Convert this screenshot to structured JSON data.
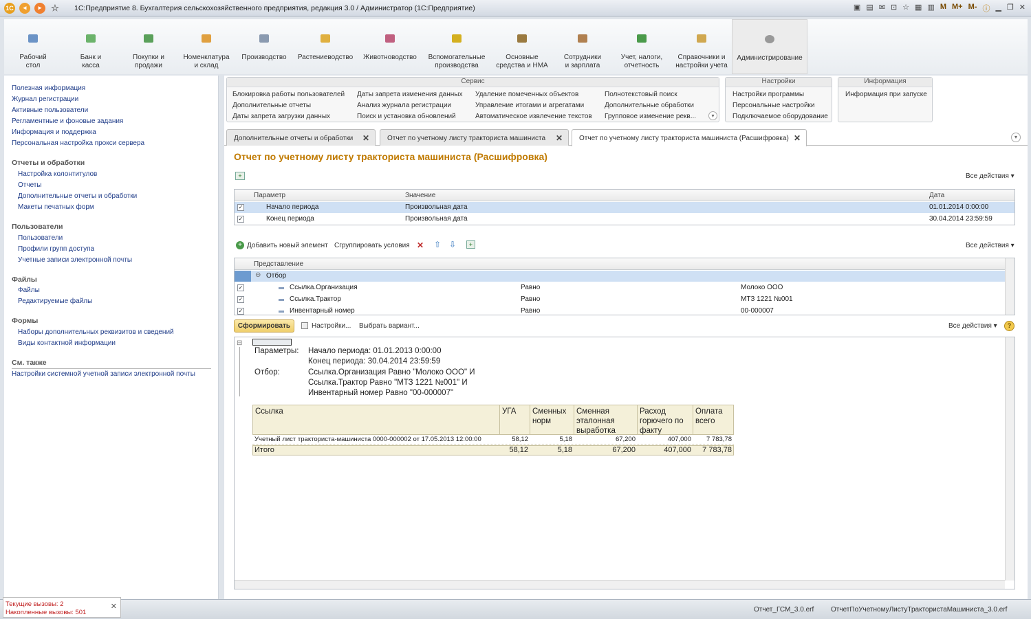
{
  "window": {
    "title": "1С:Предприятие 8. Бухгалтерия сельскохозяйственного предприятия, редакция 3.0 / Администратор  (1С:Предприятие)",
    "right_labels": [
      "M",
      "M+",
      "M-"
    ]
  },
  "sections": [
    {
      "label": "Рабочий\nстол",
      "icon": "desktop-icon"
    },
    {
      "label": "Банк и\nкасса",
      "icon": "bank-icon"
    },
    {
      "label": "Покупки и\nпродажи",
      "icon": "cart-icon"
    },
    {
      "label": "Номенклатура\nи склад",
      "icon": "box-icon"
    },
    {
      "label": "Производство",
      "icon": "factory-icon"
    },
    {
      "label": "Растениеводство",
      "icon": "plant-icon"
    },
    {
      "label": "Животноводство",
      "icon": "cow-icon"
    },
    {
      "label": "Вспомогательные\nпроизводства",
      "icon": "gear-yellow-icon"
    },
    {
      "label": "Основные\nсредства и НМА",
      "icon": "tractor-icon"
    },
    {
      "label": "Сотрудники\nи зарплата",
      "icon": "people-icon"
    },
    {
      "label": "Учет, налоги,\nотчетность",
      "icon": "book-icon"
    },
    {
      "label": "Справочники и\nнастройки учета",
      "icon": "folder-icon"
    },
    {
      "label": "Администрирование",
      "icon": "gear-icon"
    }
  ],
  "left_panel": {
    "top_links": [
      "Полезная информация",
      "Журнал регистрации",
      "Активные пользователи",
      "Регламентные и фоновые задания",
      "Информация и поддержка",
      "Персональная настройка прокси сервера"
    ],
    "groups": [
      {
        "title": "Отчеты и обработки",
        "items": [
          "Настройка колонтитулов",
          "Отчеты",
          "Дополнительные отчеты и обработки",
          "Макеты печатных форм"
        ]
      },
      {
        "title": "Пользователи",
        "items": [
          "Пользователи",
          "Профили групп доступа",
          "Учетные записи электронной почты"
        ]
      },
      {
        "title": "Файлы",
        "items": [
          "Файлы",
          "Редактируемые файлы"
        ]
      },
      {
        "title": "Формы",
        "items": [
          "Наборы дополнительных реквизитов и сведений",
          "Виды контактной информации"
        ]
      }
    ],
    "see_also_title": "См. также",
    "see_also": [
      "Настройки системной учетной записи электронной почты"
    ]
  },
  "command_groups": {
    "service": {
      "title": "Сервис",
      "cols": [
        [
          "Блокировка работы пользователей",
          "Дополнительные отчеты",
          "Даты запрета загрузки данных"
        ],
        [
          "Даты запрета изменения данных",
          "Анализ журнала регистрации",
          "Поиск и установка обновлений"
        ],
        [
          "Удаление помеченных объектов",
          "Управление итогами и агрегатами",
          "Автоматическое извлечение текстов"
        ],
        [
          "Полнотекстовый поиск",
          "Дополнительные обработки",
          "Групповое изменение рекв..."
        ]
      ]
    },
    "settings": {
      "title": "Настройки",
      "items": [
        "Настройки программы",
        "Персональные настройки",
        "Подключаемое оборудование"
      ]
    },
    "info": {
      "title": "Информация",
      "items": [
        "Информация при запуске"
      ]
    }
  },
  "tabs": [
    "Дополнительные отчеты и обработки",
    "Отчет по учетному листу тракториста машиниста",
    "Отчет по учетному листу тракториста машиниста (Расшифровка)"
  ],
  "form": {
    "title": "Отчет по учетному листу тракториста машиниста (Расшифровка)",
    "all_actions": "Все действия ▾",
    "params": {
      "headers": [
        "Параметр",
        "Значение",
        "Дата"
      ],
      "rows": [
        {
          "name": "Начало периода",
          "value": "Произвольная дата",
          "date": "01.01.2014 0:00:00",
          "checked": true
        },
        {
          "name": "Конец периода",
          "value": "Произвольная дата",
          "date": "30.04.2014 23:59:59",
          "checked": true
        }
      ]
    },
    "filter_toolbar": {
      "add": "Добавить новый элемент",
      "group": "Сгруппировать условия"
    },
    "filters": {
      "header": "Представление",
      "group": "Отбор",
      "rows": [
        {
          "field": "Ссылка.Организация",
          "op": "Равно",
          "value": "Молоко ООО"
        },
        {
          "field": "Ссылка.Трактор",
          "op": "Равно",
          "value": "МТЗ 1221 №001"
        },
        {
          "field": "Инвентарный номер",
          "op": "Равно",
          "value": "00-000007"
        }
      ]
    },
    "report_toolbar": {
      "generate": "Сформировать",
      "settings": "Настройки...",
      "variant": "Выбрать вариант...",
      "help": "?"
    }
  },
  "report": {
    "params_label": "Параметры:",
    "param_lines": [
      "Начало периода: 01.01.2013 0:00:00",
      "Конец периода: 30.04.2014 23:59:59"
    ],
    "filter_label": "Отбор:",
    "filter_lines": [
      "Ссылка.Организация Равно \"Молоко ООО\" И",
      "Ссылка.Трактор Равно \"МТЗ 1221 №001\" И",
      "Инвентарный номер Равно \"00-000007\""
    ],
    "headers": [
      "Ссылка",
      "УГА",
      "Сменных\nнорм",
      "Сменная\nэталонная\nвыработка",
      "Расход\nгорючего по\nфакту",
      "Оплата\nвсего"
    ],
    "rows": [
      [
        "Учетный лист тракториста-машиниста 0000-000002 от 17.05.2013 12:00:00",
        "58,12",
        "5,18",
        "67,200",
        "407,000",
        "7 783,78"
      ]
    ],
    "total": [
      "Итого",
      "58,12",
      "5,18",
      "67,200",
      "407,000",
      "7 783,78"
    ]
  },
  "status": {
    "calls": "Текущие вызовы: 2",
    "accumulated": "Накопленные вызовы: 501",
    "files": [
      "Отчет_ГСМ_3.0.erf",
      "ОтчетПоУчетномуЛистуТрактористаМашиниста_3.0.erf"
    ]
  }
}
